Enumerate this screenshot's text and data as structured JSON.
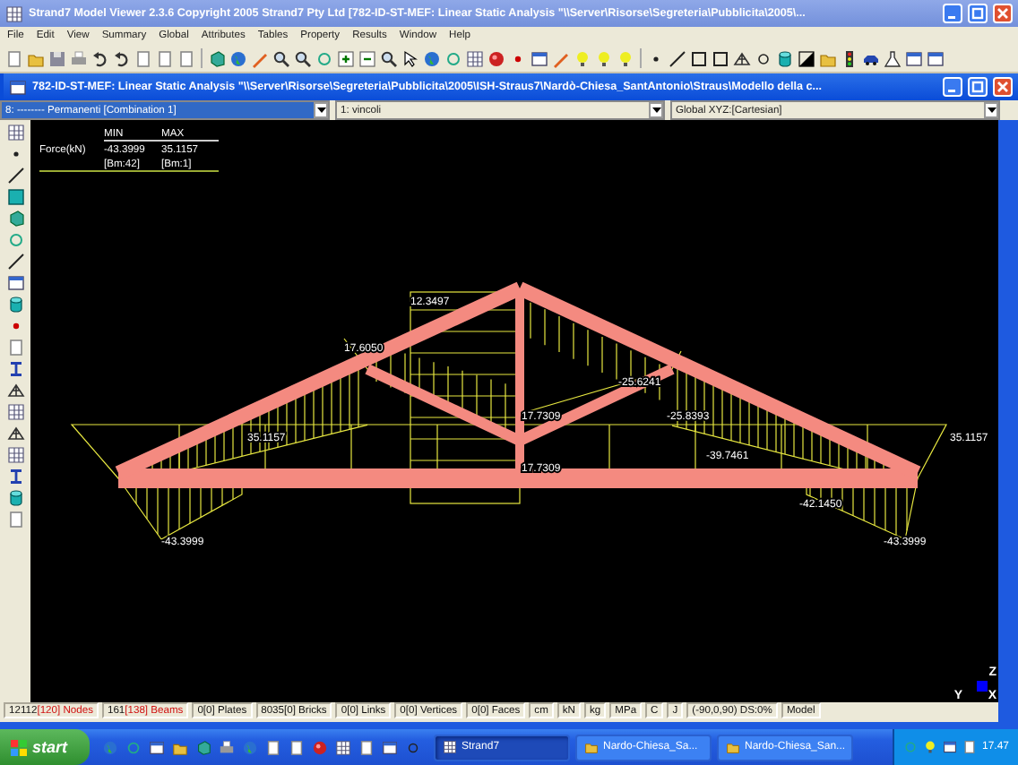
{
  "app_window": {
    "title": "Strand7 Model Viewer 2.3.6 Copyright 2005 Strand7 Pty Ltd [782-ID-ST-MEF: Linear Static Analysis \"\\\\Server\\Risorse\\Segreteria\\Pubblicita\\2005\\..."
  },
  "menu": [
    "File",
    "Edit",
    "View",
    "Summary",
    "Global",
    "Attributes",
    "Tables",
    "Property",
    "Results",
    "Window",
    "Help"
  ],
  "document_window": {
    "title": "782-ID-ST-MEF: Linear Static Analysis \"\\\\Server\\Risorse\\Segreteria\\Pubblicita\\2005\\ISH-Straus7\\Nardò-Chiesa_SantAntonio\\Straus\\Modello della c..."
  },
  "selectors": [
    {
      "value": "8: -------- Permanenti [Combination 1]",
      "selected": true
    },
    {
      "value": "1: vincoli",
      "selected": false
    },
    {
      "value": "Global XYZ:[Cartesian]",
      "selected": false
    }
  ],
  "legend": {
    "columns": [
      "MIN",
      "MAX"
    ],
    "quantity": "Force(kN)",
    "min": "-43.3999",
    "max": "35.1157",
    "min_ref": "[Bm:42]",
    "max_ref": "[Bm:1]"
  },
  "diagram_labels": [
    "12.3497",
    "17.6050",
    "35.1157",
    "17.7309",
    "17.7309",
    "-25.6241",
    "-25.8393",
    "-39.7461",
    "-42.1450",
    "35.1157",
    "-43.3999",
    "-43.3999"
  ],
  "axes": {
    "z": "Z",
    "y": "Y",
    "x": "X"
  },
  "status_bar": [
    {
      "kind": "count",
      "number": "12112",
      "detail": "[120] Nodes",
      "highlight": true
    },
    {
      "kind": "count",
      "number": "161",
      "detail": "[138] Beams",
      "highlight": true
    },
    {
      "kind": "count",
      "number": "0",
      "detail": "[0] Plates",
      "highlight": false
    },
    {
      "kind": "count",
      "number": "8035",
      "detail": "[0] Bricks",
      "highlight": false
    },
    {
      "kind": "count",
      "number": "0",
      "detail": "[0] Links",
      "highlight": false
    },
    {
      "kind": "count",
      "number": "0",
      "detail": "[0] Vertices",
      "highlight": false
    },
    {
      "kind": "count",
      "number": "0",
      "detail": "[0] Faces",
      "highlight": false
    },
    {
      "kind": "plain",
      "text": "cm"
    },
    {
      "kind": "plain",
      "text": "kN"
    },
    {
      "kind": "plain",
      "text": "kg"
    },
    {
      "kind": "plain",
      "text": "MPa"
    },
    {
      "kind": "plain",
      "text": "C"
    },
    {
      "kind": "plain",
      "text": "J"
    },
    {
      "kind": "plain",
      "text": "(-90,0,90)  DS:0%"
    },
    {
      "kind": "plain",
      "text": "Model"
    }
  ],
  "taskbar": {
    "start": "start",
    "tasks": [
      {
        "label": "Strand7",
        "selected": true
      },
      {
        "label": "Nardo-Chiesa_Sa...",
        "selected": false
      },
      {
        "label": "Nardo-Chiesa_San...",
        "selected": false
      }
    ],
    "clock": "17.47"
  }
}
